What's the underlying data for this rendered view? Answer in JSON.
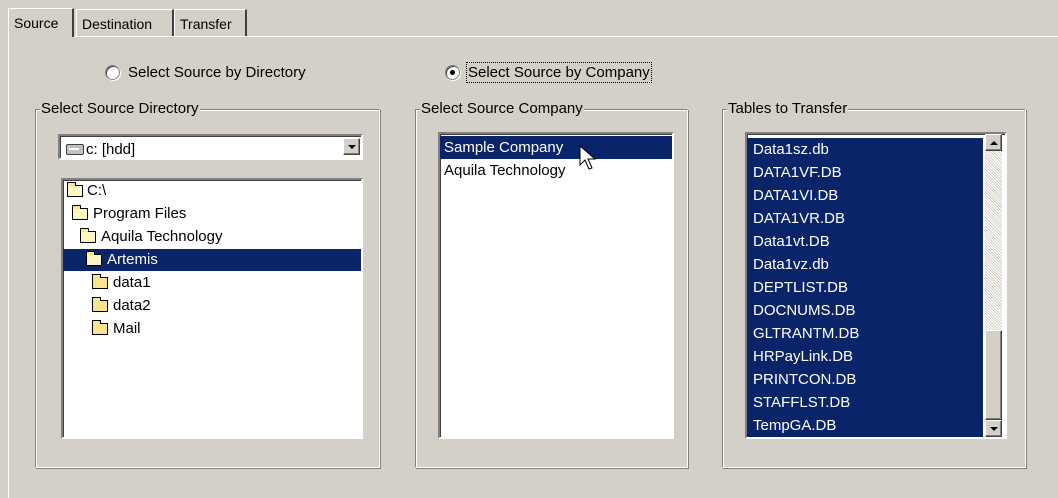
{
  "tabs": [
    {
      "label": "Source",
      "active": true
    },
    {
      "label": "Destination",
      "active": false
    },
    {
      "label": "Transfer",
      "active": false
    }
  ],
  "source_mode": {
    "options": [
      {
        "label": "Select Source by Directory",
        "checked": false
      },
      {
        "label": "Select Source by Company",
        "checked": true
      }
    ]
  },
  "directory_group": {
    "title": "Select Source Directory",
    "drive": {
      "value": "c: [hdd]",
      "icon": "drive-icon"
    },
    "tree": [
      {
        "label": "C:\\",
        "icon": "open-folder-icon",
        "selected": false
      },
      {
        "label": "Program Files",
        "icon": "open-folder-icon",
        "selected": false
      },
      {
        "label": "Aquila Technology",
        "icon": "open-folder-icon",
        "selected": false
      },
      {
        "label": "Artemis",
        "icon": "open-folder-icon",
        "selected": true
      },
      {
        "label": "data1",
        "icon": "folder-icon",
        "selected": false
      },
      {
        "label": "data2",
        "icon": "folder-icon",
        "selected": false
      },
      {
        "label": "Mail",
        "icon": "folder-icon",
        "selected": false
      }
    ]
  },
  "company_group": {
    "title": "Select Source Company",
    "companies": [
      {
        "label": "Sample Company",
        "selected": true
      },
      {
        "label": "Aquila Technology",
        "selected": false
      }
    ]
  },
  "tables_group": {
    "title": "Tables to Transfer",
    "tables": [
      "Data1sz.db",
      "DATA1VF.DB",
      "DATA1VI.DB",
      "DATA1VR.DB",
      "Data1vt.DB",
      "Data1vz.db",
      "DEPTLIST.DB",
      "DOCNUMS.DB",
      "GLTRANTM.DB",
      "HRPayLink.DB",
      "PRINTCON.DB",
      "STAFFLST.DB",
      "TempGA.DB"
    ]
  },
  "colors": {
    "face": "#d4d0c8",
    "selection": "#0a246a",
    "window": "#ffffff"
  }
}
